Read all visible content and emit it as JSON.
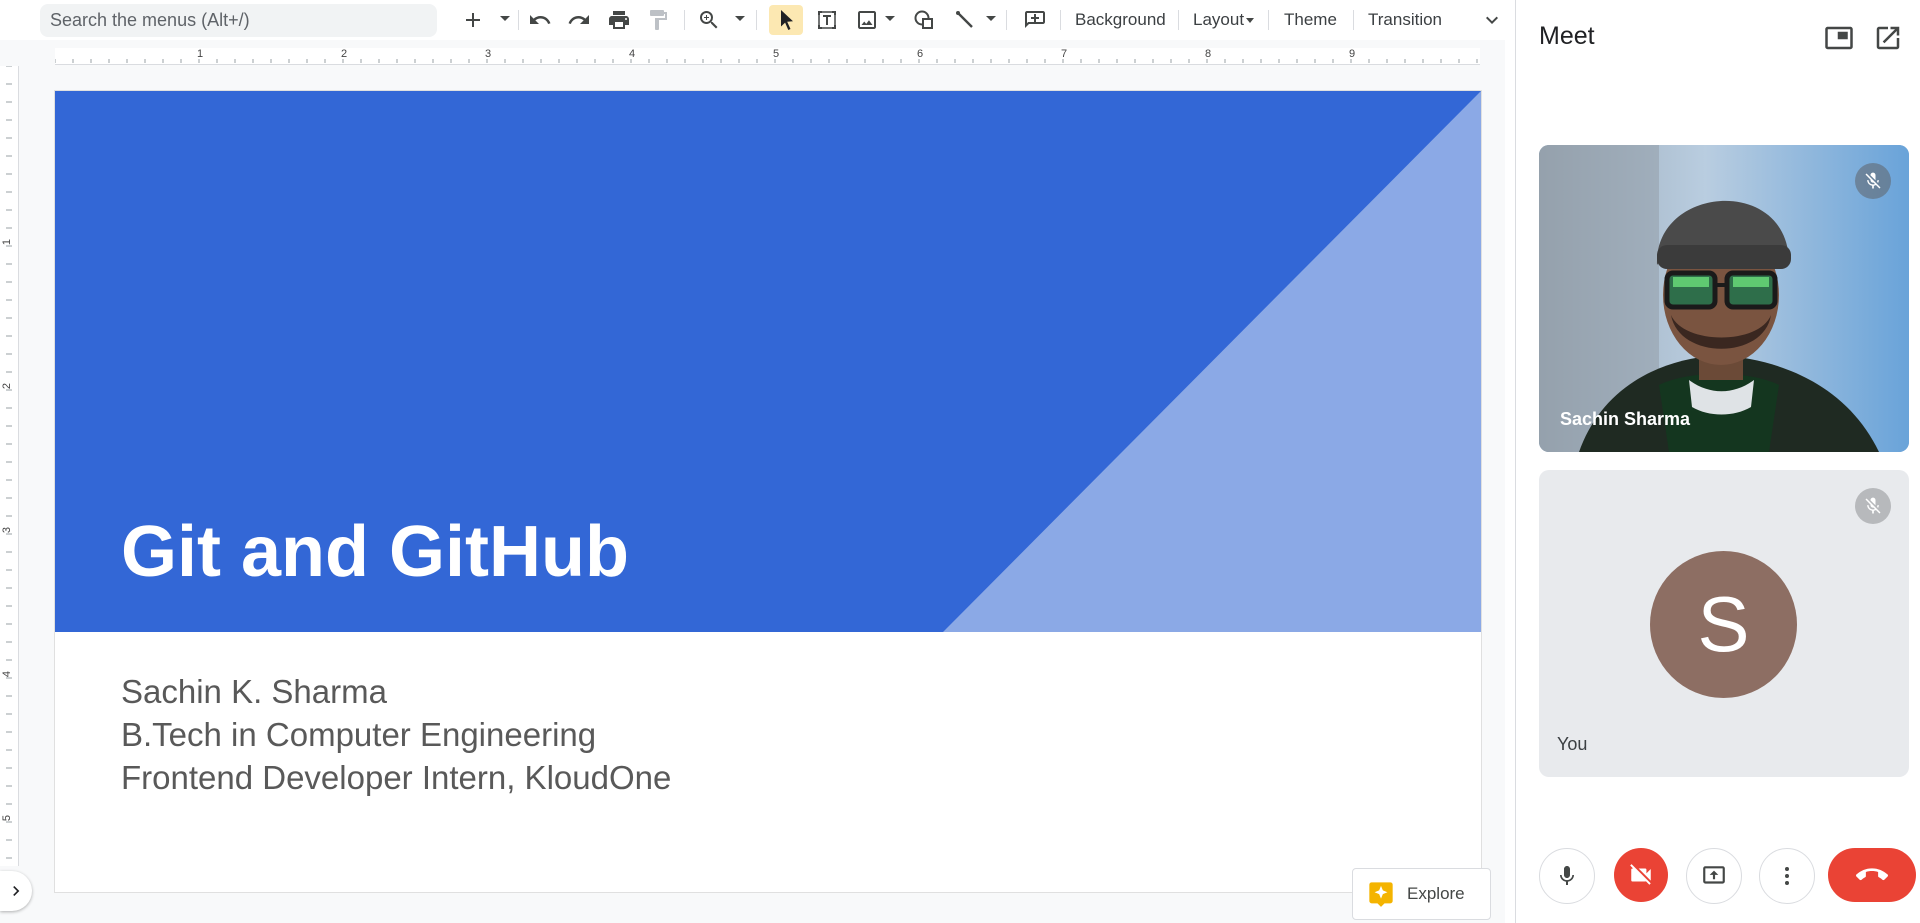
{
  "toolbar": {
    "search_placeholder": "Search the menus (Alt+/)",
    "background_label": "Background",
    "layout_label": "Layout",
    "theme_label": "Theme",
    "transition_label": "Transition",
    "icons": [
      "add-icon",
      "undo-icon",
      "redo-icon",
      "print-icon",
      "paint-format-icon",
      "zoom-icon",
      "select-icon",
      "text-box-icon",
      "image-icon",
      "shape-icon",
      "line-icon",
      "comment-icon",
      "collapse-icon"
    ]
  },
  "ruler": {
    "horizontal_labels": [
      "1",
      "2",
      "3",
      "4",
      "5",
      "6",
      "7",
      "8",
      "9"
    ],
    "vertical_labels": [
      "1",
      "2",
      "3",
      "4",
      "5"
    ]
  },
  "slide": {
    "title": "Git and GitHub",
    "subtitle_lines": [
      "Sachin K. Sharma",
      "B.Tech in Computer Engineering",
      "Frontend Developer Intern, KloudOne"
    ],
    "colors": {
      "primary_blue": "#3367d6",
      "light_blue": "#8ba9e6",
      "subtitle_text": "#595959"
    }
  },
  "explore": {
    "label": "Explore"
  },
  "meet": {
    "title": "Meet",
    "participants": [
      {
        "name": "Sachin Sharma",
        "muted": true,
        "video": true
      },
      {
        "name": "You",
        "muted": true,
        "video": false,
        "avatar_letter": "S",
        "avatar_color": "#8d6e63"
      }
    ],
    "controls": [
      "microphone-icon",
      "camera-off-icon",
      "present-icon",
      "more-options-icon",
      "leave-call-icon"
    ],
    "accent_red": "#ea4335"
  }
}
